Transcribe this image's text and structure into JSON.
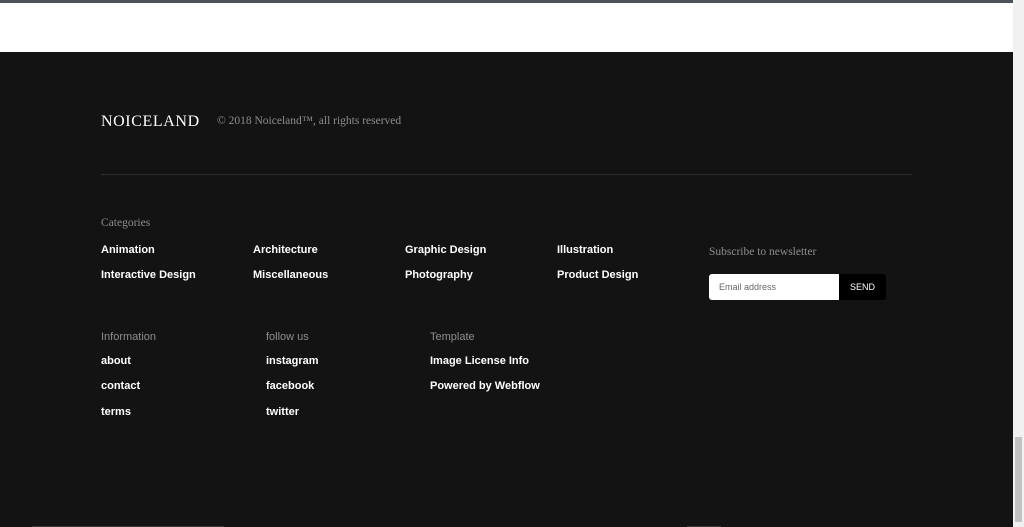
{
  "footer": {
    "brand": "NOICELAND",
    "copyright": "© 2018 Noiceland™, all rights reserved",
    "categories": {
      "heading": "Categories",
      "items": [
        "Animation",
        "Architecture",
        "Graphic Design",
        "Illustration",
        "Interactive Design",
        "Miscellaneous",
        "Photography",
        "Product Design"
      ]
    },
    "newsletter": {
      "heading": "Subscribe to newsletter",
      "placeholder": "Email address",
      "button": "SEND"
    },
    "information": {
      "heading": "Information",
      "items": [
        "about",
        "contact",
        "terms"
      ]
    },
    "follow": {
      "heading": "follow us",
      "items": [
        "instagram",
        "facebook",
        "twitter"
      ]
    },
    "template": {
      "heading": "Template",
      "items": [
        "Image License Info",
        "Powered by Webflow"
      ]
    }
  },
  "colors": {
    "footer_bg": "#141313",
    "muted_text": "#8e8e8e",
    "link_text": "#ffffff"
  }
}
